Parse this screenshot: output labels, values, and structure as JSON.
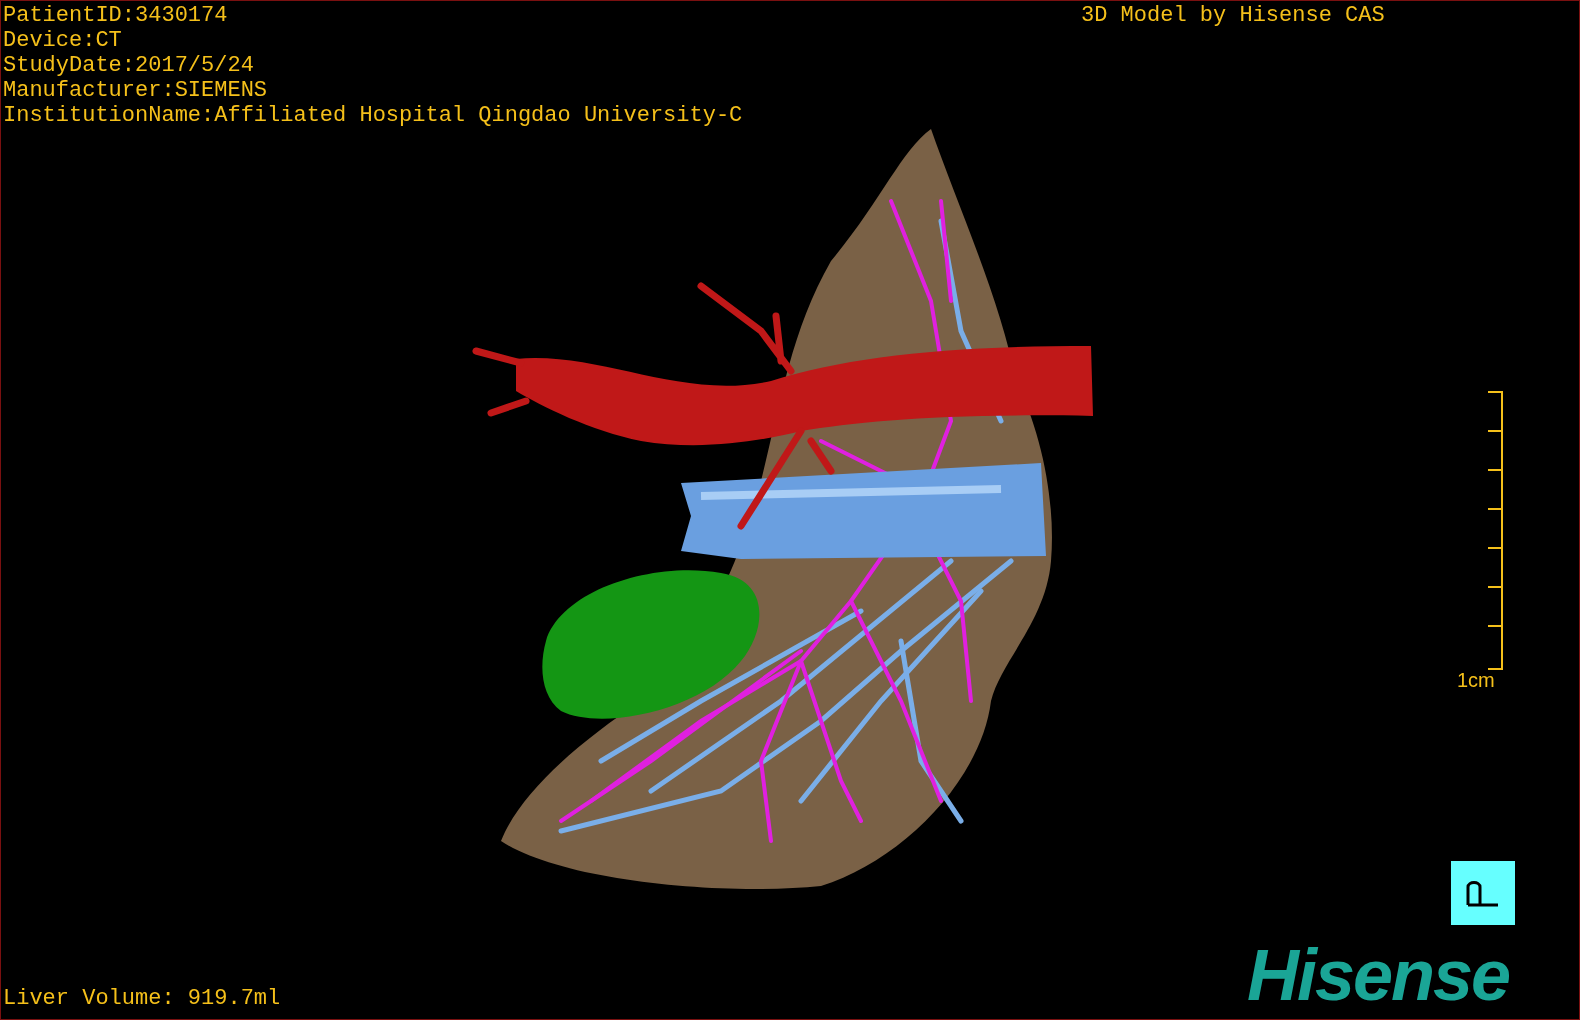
{
  "study_info": [
    "PatientID:3430174",
    "Device:CT",
    "StudyDate:2017/5/24",
    "Manufacturer:SIEMENS",
    "InstitutionName:Affiliated Hospital Qingdao University-C"
  ],
  "model_credit": "3D Model by Hisense CAS",
  "scale_bar": {
    "label": "1cm"
  },
  "liver_volume": "Liver Volume: 919.7ml",
  "logo": "Hisense"
}
